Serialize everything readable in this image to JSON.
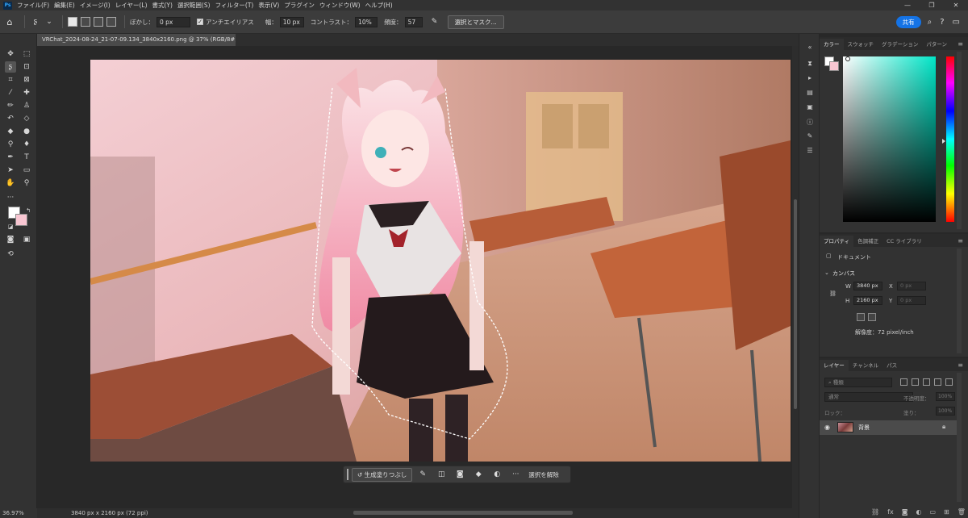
{
  "menubar": {
    "app_logo": "Ps",
    "items": [
      "ファイル(F)",
      "編集(E)",
      "イメージ(I)",
      "レイヤー(L)",
      "書式(Y)",
      "選択範囲(S)",
      "フィルター(T)",
      "表示(V)",
      "プラグイン",
      "ウィンドウ(W)",
      "ヘルプ(H)"
    ],
    "window_buttons": [
      "—",
      "❐",
      "✕"
    ]
  },
  "options": {
    "feather_label": "ぼかし：",
    "feather_value": "0 px",
    "antialias_label": "アンチエイリアス",
    "width_label": "幅：",
    "width_value": "10 px",
    "contrast_label": "コントラスト：",
    "contrast_value": "10%",
    "frequency_label": "頻度：",
    "frequency_value": "57",
    "select_mask_label": "選択とマスク...",
    "share_label": "共有"
  },
  "document": {
    "tab_title": "VRChat_2024-08-24_21-07-09.134_3840x2160.png @ 37% (RGB/8#) *",
    "tab_close": "×"
  },
  "taskbar": {
    "generative_fill_label": "生成塗りつぶし",
    "deselect_label": "選択を解除",
    "more": "···"
  },
  "status": {
    "zoom": "36.97%",
    "dimensions": "3840 px x 2160 px (72 ppi)"
  },
  "color_panel": {
    "tabs": [
      "カラー",
      "スウォッチ",
      "グラデーション",
      "パターン"
    ],
    "foreground": "#ffffff",
    "background": "#f8c6d2"
  },
  "properties_panel": {
    "tabs": [
      "プロパティ",
      "色調補正",
      "CC ライブラリ"
    ],
    "document_label": "ドキュメント",
    "canvas_label": "カンバス",
    "w_label": "W",
    "w_value": "3840 px",
    "h_label": "H",
    "h_value": "2160 px",
    "x_label": "X",
    "x_value": "0 px",
    "y_label": "Y",
    "y_value": "0 px",
    "resolution": "解像度：72 pixel/inch"
  },
  "layers_panel": {
    "tabs": [
      "レイヤー",
      "チャンネル",
      "パス"
    ],
    "search_placeholder": "種類",
    "blend_mode": "通常",
    "opacity_label": "不透明度：",
    "opacity_value": "100%",
    "lock_label": "ロック：",
    "fill_label": "塗り：",
    "fill_value": "100%",
    "layer_name": "背景"
  }
}
